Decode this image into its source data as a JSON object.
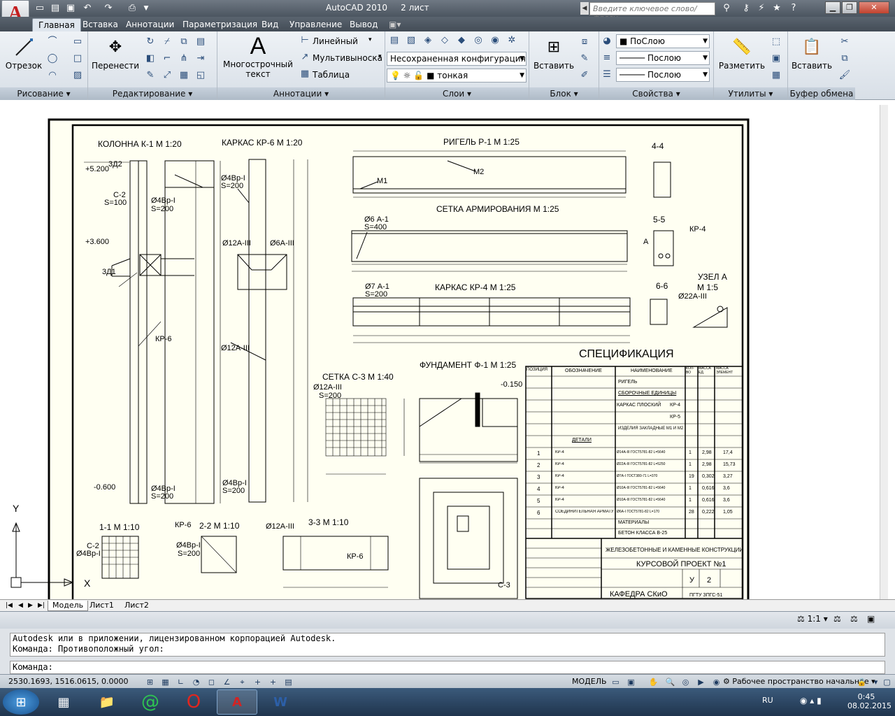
{
  "window": {
    "title": "AutoCAD 2010",
    "sheets": "2 лист"
  },
  "search": {
    "placeholder": "Введите ключевое слово/фразу"
  },
  "tabs": [
    "Главная",
    "Вставка",
    "Аннотации",
    "Параметризация",
    "Вид",
    "Управление",
    "Вывод"
  ],
  "ribbon": {
    "draw": {
      "line": "Отрезок",
      "title": "Рисование"
    },
    "modify": {
      "move": "Перенести",
      "title": "Редактирование"
    },
    "annot": {
      "mtext": "Многострочный",
      "mtext2": "текст",
      "linear": "Линейный",
      "mleader": "Мультивыноска",
      "table": "Таблица",
      "title": "Аннотации"
    },
    "layers": {
      "config": "Несохраненная конфигурация сл",
      "layer": "тонкая",
      "title": "Слои"
    },
    "block": {
      "insert": "Вставить",
      "title": "Блок"
    },
    "props": {
      "color": "ПоСлою",
      "ltype": "Послою",
      "lweight": "Послою",
      "title": "Свойства"
    },
    "utils": {
      "measure": "Разметить",
      "title": "Утилиты"
    },
    "clip": {
      "paste": "Вставить",
      "title": "Буфер обмена"
    }
  },
  "drawing": {
    "t_col": "КОЛОННА К-1 М 1:20",
    "t_kr6": "КАРКАС КР-6 М 1:20",
    "t_rig": "РИГЕЛЬ Р-1 М 1:25",
    "t_44": "4-4",
    "t_grid": "СЕТКА АРМИРОВАНИЯ М 1:25",
    "t_55": "5-5",
    "t_kr4": "КАРКАС КР-4 М 1:25",
    "t_66": "6-6",
    "t_node": "УЗЕЛ А",
    "t_node2": "М 1:5",
    "t_spec": "СПЕЦИФИКАЦИЯ",
    "t_found": "ФУНДАМЕНТ Ф-1 М 1:25",
    "t_c3": "СЕТКА С-3 М 1:40",
    "t_11": "1-1 М 1:10",
    "t_22": "2-2 М 1:10",
    "t_33": "3-3 М 1:10",
    "l_5200": "+5.200",
    "l_3600": "+3.600",
    "l_m0600": "-0.600",
    "l_m0150": "-0.150",
    "l_c2": "С-2",
    "l_s100": "S=100",
    "l_s200": "S=200",
    "l_d4": "Ø4Вр-I",
    "l_d12": "Ø12А-III",
    "l_d6": "Ø6А-III",
    "l_d6a1": "Ø6 А-1",
    "l_s400": "S=400",
    "l_d7": "Ø7 А-1",
    "l_d22": "Ø22А-III",
    "l_kr6": "КР-6",
    "l_kr4": "КР-4",
    "l_m1": "М1",
    "l_m2": "М2",
    "l_3d2": "3Д2",
    "l_3d1": "3Д1",
    "l_c3": "С-3",
    "l_a": "А",
    "spec_rows": [
      {
        "pos": "1",
        "mark": "КР-4",
        "name": "Ø14А-III ГОСТ5781-82 L=5640",
        "qty": "1",
        "mass": "2,98",
        "tot": "17,4"
      },
      {
        "pos": "2",
        "mark": "КР-4",
        "name": "Ø22А-III ГОСТ5781-82 L=5250",
        "qty": "1",
        "mass": "2,98",
        "tot": "15,73"
      },
      {
        "pos": "3",
        "mark": "КР-4",
        "name": "Ø7А-I ГОСТ380-71 L=370",
        "qty": "19",
        "mass": "0,302",
        "tot": "3,27"
      },
      {
        "pos": "4",
        "mark": "КР-4",
        "name": "Ø10А-III ГОСТ5781-82 L=5640",
        "qty": "1",
        "mass": "0,616",
        "tot": "3,6"
      },
      {
        "pos": "5",
        "mark": "КР-4",
        "name": "Ø10А-III ГОСТ5781-82 L=5640",
        "qty": "1",
        "mass": "0,616",
        "tot": "3,6"
      },
      {
        "pos": "6",
        "mark": "СОЕДИНИТЕЛЬНАЯ АРМАТУРА",
        "name": "Ø6А-I ГОСТ5781-82 L=170",
        "qty": "28",
        "mass": "0,222",
        "tot": "1,05"
      }
    ],
    "spec_head": {
      "pos": "ПОЗИЦИЯ",
      "mark": "ОБОЗНАЧЕНИЕ",
      "name": "НАИМЕНОВАНИЕ",
      "qty": "КОЛ-ВО",
      "mass": "МАССА ЕД.",
      "tot": "МАССА ЭЛЕМЕНТ"
    },
    "spec_texts": {
      "rig": "РИГЕЛЬ",
      "asm": "СБОРОЧНЫЕ ЕДИНИЦЫ",
      "kp": "КАРКАС ПЛОСКИЙ",
      "kr4": "КР-4",
      "kr5": "КР-5",
      "emb": "ИЗДЕЛИЯ ЗАКЛАДНЫЕ М1 И М2",
      "det": "ДЕТАЛИ",
      "mat": "МАТЕРИАЛЫ",
      "conc": "БЕТОН КЛАССА В-25"
    },
    "stamp": {
      "title": "ЖЕЛЕЗОБЕТОННЫЕ И КАМЕННЫЕ КОНСТРУКЦИИ",
      "proj": "КУРСОВОЙ ПРОЕКТ №1",
      "dept": "КАФЕДРА СКиО",
      "grp": "ПГТУ ЗПГС-51",
      "stage": "У",
      "sheet": "2"
    }
  },
  "layouts": [
    "Модель",
    "Лист1",
    "Лист2"
  ],
  "scale": "1:1",
  "cmd": {
    "line1": "Autodesk или в приложении, лицензированном корпорацией Autodesk.",
    "line2": "Команда: Противоположный угол:",
    "prompt": "Команда:"
  },
  "status": {
    "coords": "2530.1693, 1516.0615, 0.0000",
    "model": "МОДЕЛЬ",
    "workspace": "Рабочее пространство начальное"
  },
  "taskbar": {
    "lang": "RU",
    "time": "0:45",
    "date": "08.02.2015"
  },
  "colors": {
    "accent": "#c41e1e",
    "ribbon": "#dfe6ee",
    "paper": "#fffff2"
  }
}
